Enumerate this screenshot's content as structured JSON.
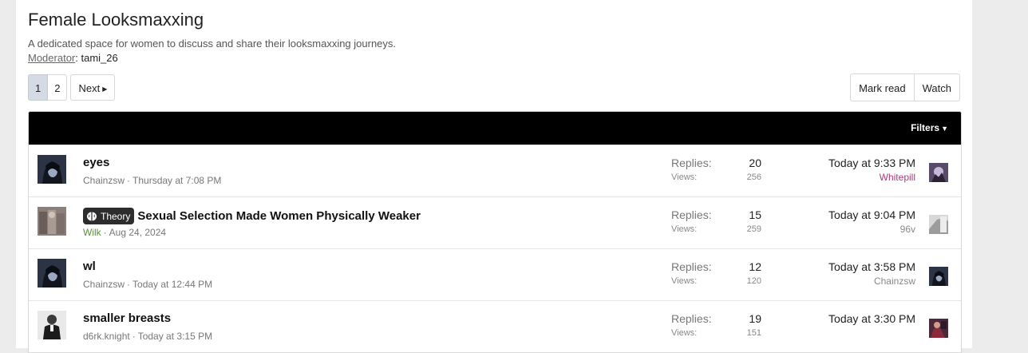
{
  "page": {
    "title": "Female Looksmaxxing",
    "description": "A dedicated space for women to discuss and share their looksmaxxing journeys.",
    "moderator_label": "Moderator",
    "moderator_sep": ":",
    "moderator_name": "tami_26"
  },
  "pagination": {
    "pages": [
      "1",
      "2"
    ],
    "current": "1",
    "next_label": "Next"
  },
  "actions": {
    "mark_read": "Mark read",
    "watch": "Watch"
  },
  "list_header": {
    "filters_label": "Filters"
  },
  "labels": {
    "replies": "Replies:",
    "views": "Views:",
    "meta_sep": "·"
  },
  "threads": [
    {
      "title": "eyes",
      "prefix": "",
      "author": "Chainzsw",
      "date": "Thursday at 7:08 PM",
      "replies": "20",
      "views": "256",
      "last_time": "Today at 9:33 PM",
      "last_user": "Whitepill"
    },
    {
      "title": "Sexual Selection Made Women Physically Weaker",
      "prefix": "Theory",
      "author": "Wilk",
      "date": "Aug 24, 2024",
      "replies": "15",
      "views": "259",
      "last_time": "Today at 9:04 PM",
      "last_user": "96v"
    },
    {
      "title": "wl",
      "prefix": "",
      "author": "Chainzsw",
      "date": "Today at 12:44 PM",
      "replies": "12",
      "views": "120",
      "last_time": "Today at 3:58 PM",
      "last_user": "Chainzsw"
    },
    {
      "title": "smaller breasts",
      "prefix": "",
      "author": "d6rk.knight",
      "date": "Today at 3:15 PM",
      "replies": "19",
      "views": "151",
      "last_time": "Today at 3:30 PM",
      "last_user": ""
    }
  ],
  "colors": {
    "header_bar": "#000000",
    "author_green": "#5a8f3a",
    "user_pink": "#b03a7d",
    "active_page": "#d4dbe4"
  },
  "icons": {
    "next": "caret-right-icon",
    "filters": "caret-down-icon",
    "prefix": "brain-icon"
  }
}
